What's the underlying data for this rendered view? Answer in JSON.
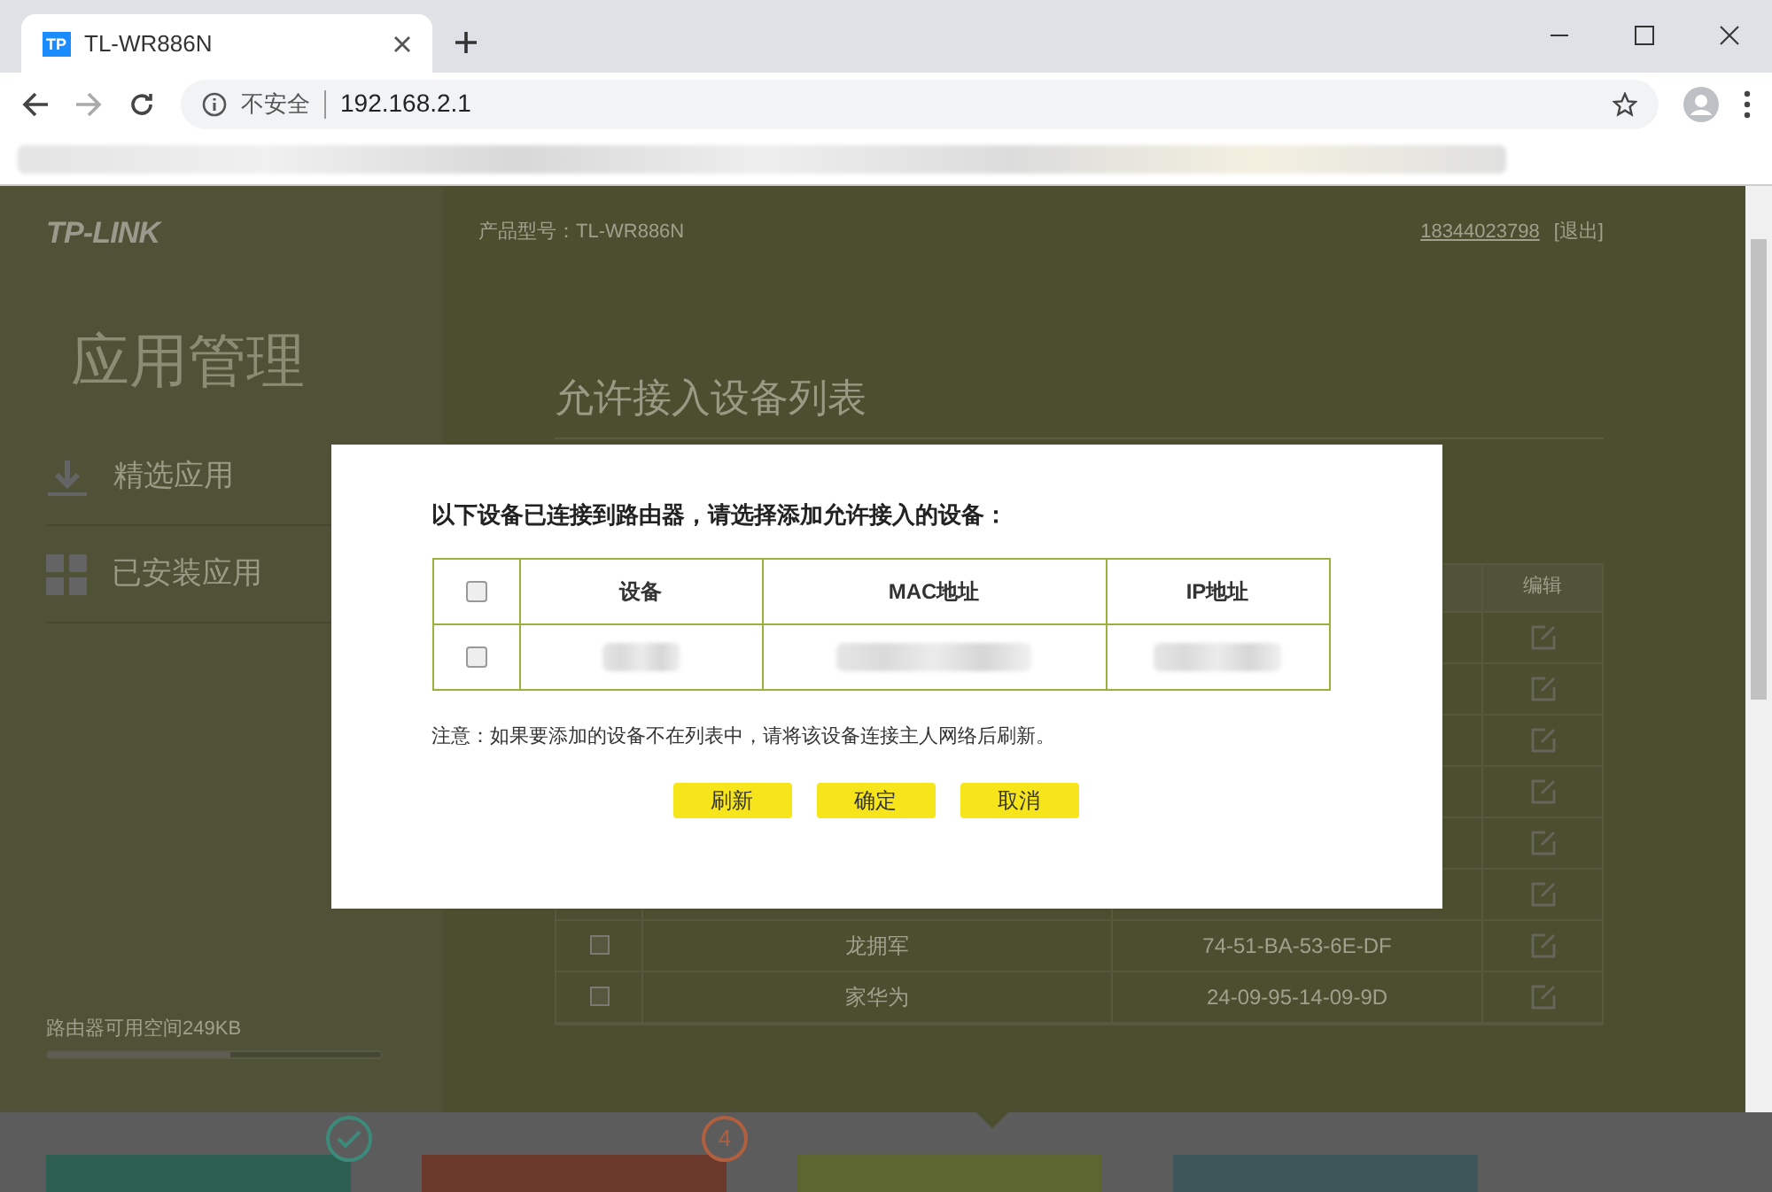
{
  "browser": {
    "tab_title": "TL-WR886N",
    "tab_icon": "TP",
    "security_label": "不安全",
    "url": "192.168.2.1"
  },
  "sidebar": {
    "logo": "TP-LINK",
    "title": "应用管理",
    "items": [
      {
        "label": "精选应用",
        "kind": "download"
      },
      {
        "label": "已安装应用",
        "kind": "grid"
      }
    ],
    "storage": {
      "label": "路由器可用空间249KB",
      "level": 0.55
    }
  },
  "header": {
    "model": "产品型号：TL-WR886N",
    "account": "18344023798",
    "logout": "[退出]"
  },
  "main": {
    "title": "允许接入设备列表",
    "edit_column": "编辑",
    "rows": [
      {
        "kind": "covered"
      },
      {
        "kind": "covered"
      },
      {
        "kind": "covered"
      },
      {
        "kind": "covered"
      },
      {
        "kind": "covered"
      },
      {
        "kind": "covered"
      },
      {
        "kind": "visible",
        "checked": false,
        "name": "龙拥军",
        "mac": "74-51-BA-53-6E-DF"
      },
      {
        "kind": "visible",
        "checked": false,
        "name": "家华为",
        "mac": "24-09-95-14-09-9D"
      }
    ]
  },
  "bottom_cards": [
    {
      "color": "#2d5e52",
      "kind": "check"
    },
    {
      "color": "#6b3a2c",
      "kind": "number",
      "badge_text": "4"
    },
    {
      "color": "#5d6530",
      "kind": "plain"
    },
    {
      "color": "#3e5559",
      "kind": "plain"
    }
  ],
  "dialog": {
    "prompt": "以下设备已连接到路由器，请选择添加允许接入的设备：",
    "select_all_checked": false,
    "columns": [
      "设备",
      "MAC地址",
      "IP地址"
    ],
    "rows": [
      {
        "checked": false
      }
    ],
    "note": "注意：如果要添加的设备不在列表中，请将该设备连接主人网络后刷新。",
    "buttons": [
      "刷新",
      "确定",
      "取消"
    ]
  }
}
